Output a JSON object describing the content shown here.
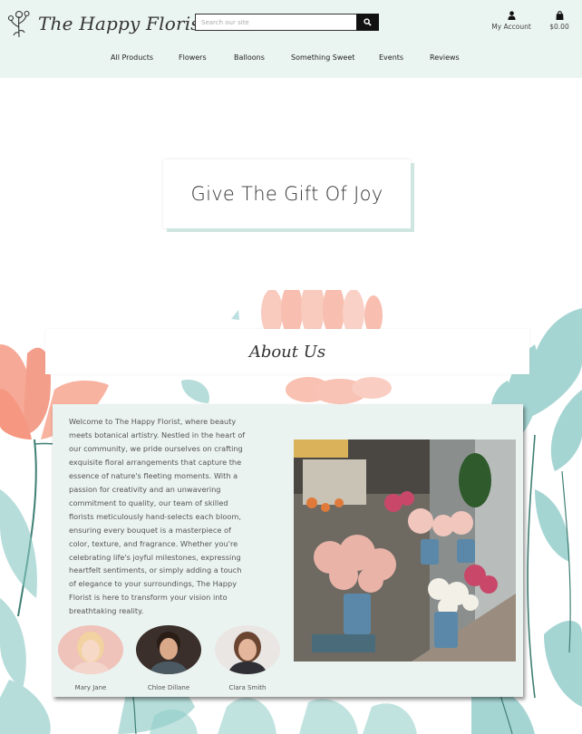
{
  "header": {
    "logo_text": "The Happy Florist",
    "search_placeholder": "Search our site",
    "account_label": "My Account",
    "cart_label": "$0.00"
  },
  "nav": {
    "items": [
      "All Products",
      "Flowers",
      "Balloons",
      "Something Sweet",
      "Events",
      "Reviews"
    ]
  },
  "hero": {
    "title": "Give The Gift Of Joy"
  },
  "about": {
    "title": "About Us",
    "paragraph_lines": [
      "Welcome to The Happy Florist, where beauty",
      "meets botanical artistry. Nestled in the heart of",
      "our community, we pride ourselves on crafting",
      "exquisite floral arrangements that capture the",
      "essence of nature's fleeting moments. With a",
      "passion for creativity and an unwavering",
      "commitment to quality, our team of skilled",
      "florists meticulously hand-selects each bloom,",
      "ensuring every bouquet is a masterpiece of",
      "color, texture, and fragrance. Whether you're",
      "celebrating life's joyful milestones, expressing",
      "heartfelt sentiments, or simply adding a touch",
      "of elegance to your surroundings, The Happy",
      "Florist is here to transform your vision into",
      "breathtaking reality."
    ],
    "team": [
      {
        "name": "Mary Jane"
      },
      {
        "name": "Chloe Dillane"
      },
      {
        "name": "Clara Smith"
      }
    ]
  },
  "colors": {
    "header_bg": "#eaf4f1",
    "card_bg": "#ebf3f0",
    "hero_shadow": "#cfe5df",
    "search_button": "#111111"
  },
  "icons": [
    "florist-logo-icon",
    "search-icon",
    "user-icon",
    "shopping-bag-icon"
  ]
}
